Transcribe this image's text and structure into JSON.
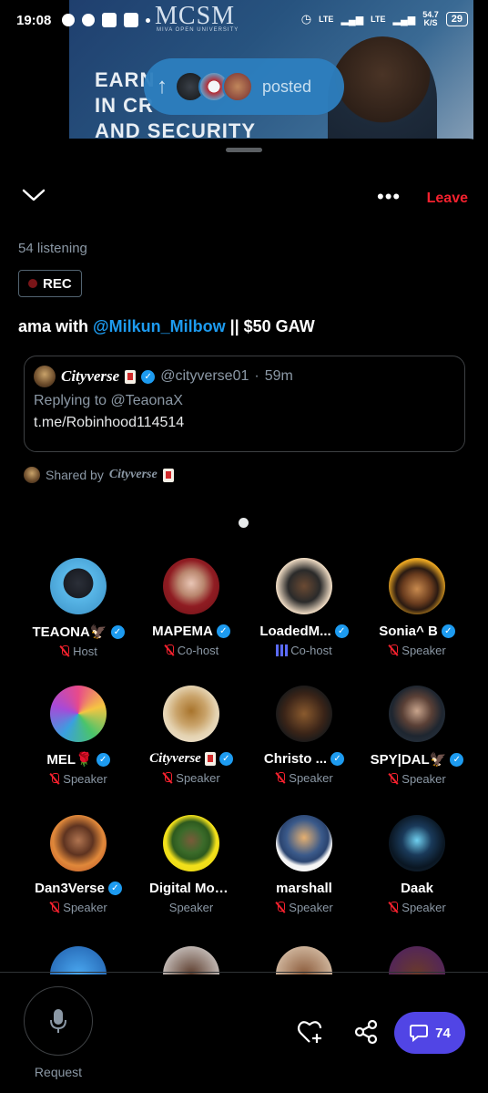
{
  "status_bar": {
    "time": "19:08",
    "network": "LTE",
    "speed": "54.7",
    "speed_unit": "K/S",
    "battery": "29"
  },
  "banner": {
    "brand": "MCSM",
    "brand_sub": "MIVA OPEN UNIVERSITY",
    "headline_line1": "EARN",
    "headline_line2": "IN CR",
    "headline_line3": "AND SECURITY"
  },
  "posted_pill": {
    "label": "posted"
  },
  "topbar": {
    "leave_label": "Leave"
  },
  "space": {
    "listening": "54 listening",
    "rec_label": "REC",
    "title_prefix": "ama with ",
    "title_mention": "@Milkun_Milbow",
    "title_suffix": " || $50 GAW"
  },
  "pinned_post": {
    "author_name": "Cityverse",
    "author_handle": "@cityverse01",
    "separator": "·",
    "time": "59m",
    "replying_to": "Replying to @TeaonaX",
    "text": "t.me/Robinhood114514"
  },
  "shared_by": {
    "prefix": "Shared by",
    "name": "Cityverse"
  },
  "participants": [
    {
      "name": "TEAONA🦅",
      "role": "Host",
      "verified": true,
      "muted": true
    },
    {
      "name": "MAPEMA",
      "role": "Co-host",
      "verified": true,
      "muted": true
    },
    {
      "name": "LoadedM...",
      "role": "Co-host",
      "verified": true,
      "muted": false,
      "speaking": true
    },
    {
      "name": "Sonia^ B",
      "role": "Speaker",
      "verified": true,
      "muted": true
    },
    {
      "name": "MEL🌹",
      "role": "Speaker",
      "verified": true,
      "muted": true
    },
    {
      "name": "Cityverse",
      "role": "Speaker",
      "verified": true,
      "muted": true
    },
    {
      "name": "Christo ...",
      "role": "Speaker",
      "verified": true,
      "muted": true
    },
    {
      "name": "SPY|DAL🦅",
      "role": "Speaker",
      "verified": true,
      "muted": true
    },
    {
      "name": "Dan3Verse",
      "role": "Speaker",
      "verified": true,
      "muted": true
    },
    {
      "name": "Digital Mon...",
      "role": "Speaker",
      "verified": false,
      "muted": false
    },
    {
      "name": "marshall",
      "role": "Speaker",
      "verified": false,
      "muted": true
    },
    {
      "name": "Daak",
      "role": "Speaker",
      "verified": false,
      "muted": true
    }
  ],
  "bottom_bar": {
    "request_label": "Request",
    "chat_count": "74"
  },
  "colors": {
    "accent_blue": "#1d9bf0",
    "leave_red": "#f4212e",
    "chat_purple": "#5145e5"
  }
}
